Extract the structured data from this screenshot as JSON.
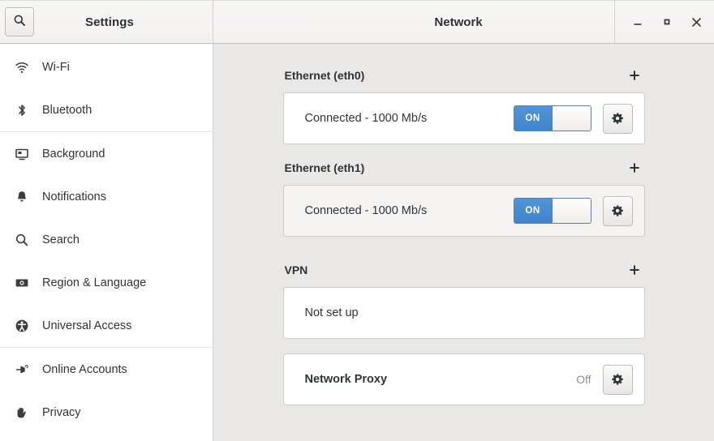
{
  "window": {
    "app_title": "Settings",
    "page_title": "Network",
    "search_icon": "search-icon",
    "controls": {
      "minimize": "minimize-icon",
      "maximize": "maximize-icon",
      "close": "close-icon"
    }
  },
  "sidebar": {
    "items": [
      {
        "label": "Wi-Fi",
        "icon": "wifi-icon"
      },
      {
        "label": "Bluetooth",
        "icon": "bluetooth-icon"
      },
      {
        "label": "Background",
        "icon": "background-icon"
      },
      {
        "label": "Notifications",
        "icon": "bell-icon"
      },
      {
        "label": "Search",
        "icon": "search-icon"
      },
      {
        "label": "Region & Language",
        "icon": "region-language-icon"
      },
      {
        "label": "Universal Access",
        "icon": "universal-access-icon"
      },
      {
        "label": "Online Accounts",
        "icon": "online-accounts-icon"
      },
      {
        "label": "Privacy",
        "icon": "privacy-hand-icon"
      }
    ],
    "separators_after": [
      1,
      6
    ]
  },
  "main": {
    "sections": [
      {
        "title": "Ethernet (eth0)",
        "add_label": "+",
        "row": {
          "status": "Connected - 1000 Mb/s",
          "toggle": "ON",
          "toggle_state": true,
          "gear": "gear-icon"
        }
      },
      {
        "title": "Ethernet (eth1)",
        "add_label": "+",
        "row": {
          "status": "Connected - 1000 Mb/s",
          "toggle": "ON",
          "toggle_state": true,
          "gear": "gear-icon"
        }
      },
      {
        "title": "VPN",
        "add_label": "+",
        "row": {
          "status": "Not set up"
        }
      }
    ],
    "proxy": {
      "label": "Network Proxy",
      "state": "Off",
      "gear": "gear-icon"
    }
  },
  "colors": {
    "accent_blue": "#4a8fd4",
    "content_bg": "#e9e8e6",
    "header_bg": "#f4f3f1",
    "text": "#2e3436",
    "muted_text": "#8e8e8a"
  }
}
